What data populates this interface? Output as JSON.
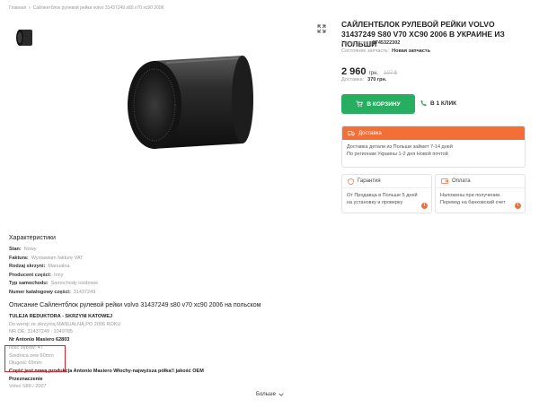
{
  "breadcrumb": {
    "home": "Главная",
    "current": "Сайлентблок рулевой рейки volvo 31437249 s80 v70 xc90 2006"
  },
  "product": {
    "title": "САЙЛЕНТБЛОК РУЛЕВОЙ РЕЙКИ VOLVO 31437249 S80 V70 XC90 2006 В УКРАИНЕ ИЗ ПОЛЬШИ",
    "part_number_label": "Номер лота:",
    "part_number": "8745322302",
    "condition_label": "Состояние запчасть:",
    "condition": "Новая запчасть",
    "price": "2 960",
    "currency": "грн.",
    "old_price": "107 $",
    "delivery_label": "Доставка:",
    "delivery_price": "370 грн."
  },
  "buttons": {
    "cart": "В КОРЗИНУ",
    "one_click": "В 1 КЛИК",
    "more": "Больше"
  },
  "delivery_box": {
    "title": "Доставка",
    "line1": "Доставка детали из Польши займет 7-14 дней",
    "line2": "По регионам Украины 1-2 дня Новой почтой"
  },
  "guarantee_box": {
    "title": "Гарантия",
    "text": "От Продавца в Польше 5 дней на установку и проверку"
  },
  "payment_box": {
    "title": "Оплата",
    "text": "Наложены при получении. Перевод на банковский счет"
  },
  "characteristics": {
    "title": "Характеристики",
    "rows": [
      {
        "label": "Stan:",
        "value": "Nowy"
      },
      {
        "label": "Faktura:",
        "value": "Wystawiam fakturę VAT"
      },
      {
        "label": "Rodzaj skrzyni:",
        "value": "Manualna"
      },
      {
        "label": "Producent części:",
        "value": "Inny"
      },
      {
        "label": "Typ samochodu:",
        "value": "Samochody osobowe"
      },
      {
        "label": "Numer katalogowy części:",
        "value": "31437249"
      }
    ]
  },
  "description": {
    "title": "Описание Сайлентблок рулевой рейки volvo 31437249 s80 v70 xc90 2006 на польском",
    "lines": [
      {
        "text": "TULEJA REDUKTORA - SKRZYNI KATOWEJ",
        "dark": true
      },
      {
        "text": "Do wersji ze skrzynią MANUALNĄ PO 2006 ROKU",
        "dark": false
      },
      {
        "text": "NR OE: 31437249 ; 1049785",
        "dark": false
      },
      {
        "text": "Nr Antonio Masiero 62803",
        "dark": true
      },
      {
        "text": "Ilość zębów: 47",
        "dark": false
      },
      {
        "text": "Średnica zew 60mm",
        "dark": false
      },
      {
        "text": "Długość 65mm",
        "dark": false
      },
      {
        "text": "Część jest nową produkcja Antonio Masiero Włochy-najwyższa półka!! jakość OEM",
        "dark": true
      },
      {
        "text": "Przeznaczenie",
        "dark": true
      },
      {
        "text": "Volvo S80 / 2007",
        "dark": false
      }
    ]
  },
  "colors": {
    "green": "#27ae60",
    "orange": "#f36f36",
    "highlight": "#d9252a"
  }
}
